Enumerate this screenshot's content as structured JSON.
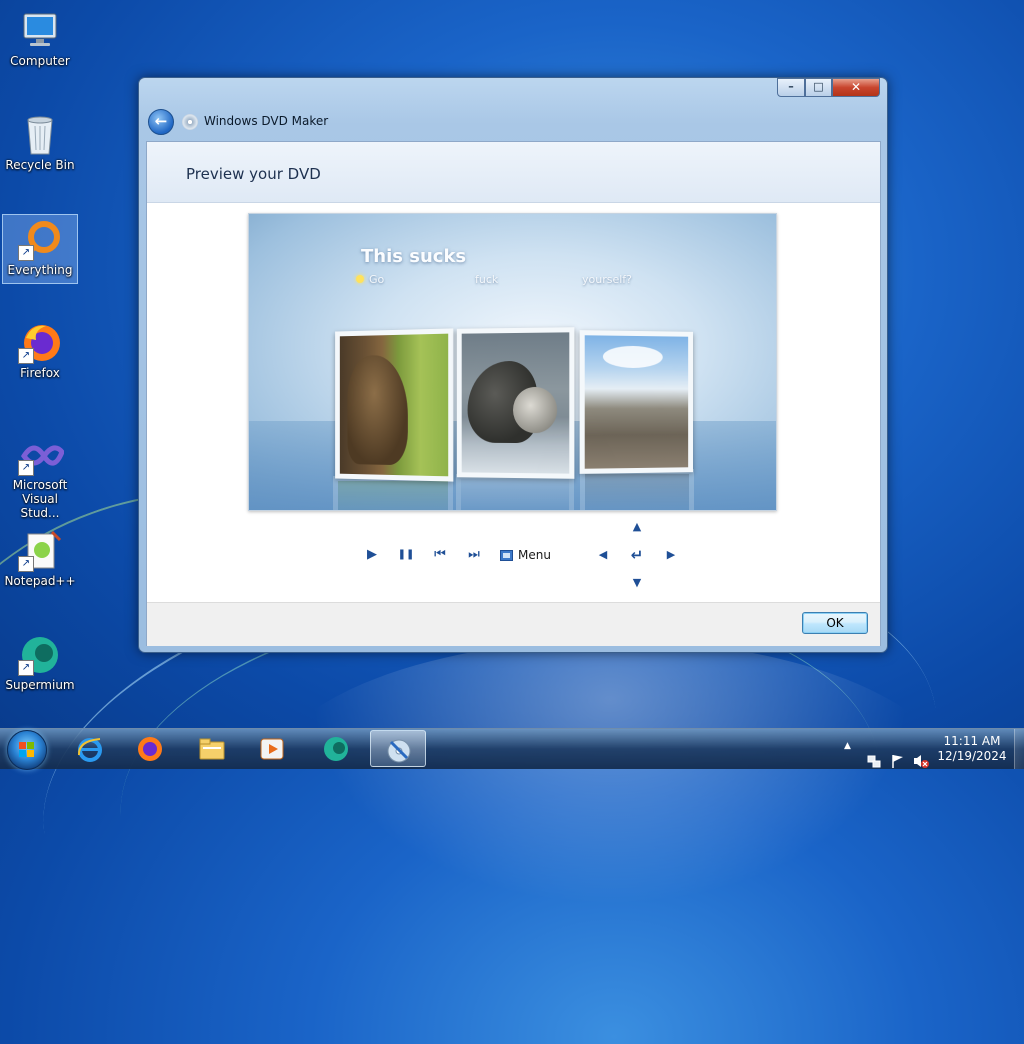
{
  "desktop": {
    "icons": [
      {
        "label": "Computer",
        "icon": "computer-icon"
      },
      {
        "label": "Recycle Bin",
        "icon": "recycle-bin-icon"
      },
      {
        "label": "Everything",
        "icon": "everything-search-icon"
      },
      {
        "label": "Firefox",
        "icon": "firefox-icon"
      },
      {
        "label": "Microsoft Visual Stud...",
        "icon": "visual-studio-icon"
      },
      {
        "label": "Notepad++",
        "icon": "notepad-plus-plus-icon"
      },
      {
        "label": "Supermium",
        "icon": "supermium-icon"
      }
    ]
  },
  "window": {
    "title": "Windows DVD Maker",
    "controls": {
      "minimize": "–",
      "maximize": "□",
      "close": "✕"
    },
    "back_glyph": "←",
    "header": "Preview your DVD",
    "preview": {
      "menu_title": "This sucks",
      "menu_items": [
        "Go",
        "fuck",
        "yourself?"
      ]
    },
    "player_controls": {
      "play": "▶",
      "pause": "❚❚",
      "previous": "⏮",
      "next": "⏭",
      "menu_label": "Menu",
      "up": "▲",
      "left": "◀",
      "enter": "↵",
      "right": "▶",
      "down": "▼"
    },
    "ok_label": "OK"
  },
  "taskbar": {
    "pinned": [
      "internet-explorer-icon",
      "firefox-icon",
      "file-explorer-icon",
      "media-player-icon",
      "supermium-icon",
      "dvd-maker-icon"
    ],
    "tray": {
      "show_hidden": "▲"
    },
    "clock": {
      "time": "11:11 AM",
      "date": "12/19/2024"
    }
  },
  "colors": {
    "accent": "#1f4f96",
    "close_button": "#c8452e"
  }
}
